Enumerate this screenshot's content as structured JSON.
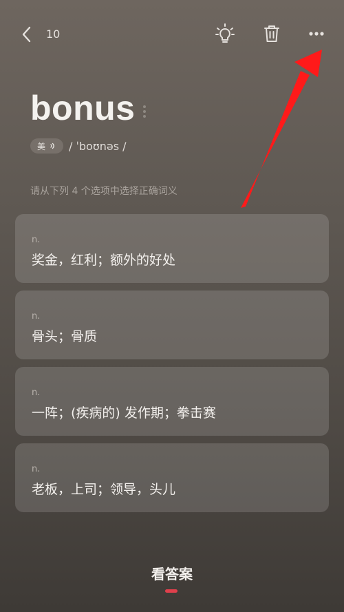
{
  "header": {
    "count": "10",
    "icons": [
      "back-chevron-icon",
      "lightbulb-icon",
      "trash-icon",
      "more-dots-icon"
    ]
  },
  "word": {
    "text": "bonus",
    "accent_label": "美",
    "phonetic": "/ ˈboʊnəs /"
  },
  "instruction": "请从下列 4 个选项中选择正确词义",
  "options": [
    {
      "pos": "n.",
      "meaning": "奖金，红利；额外的好处"
    },
    {
      "pos": "n.",
      "meaning": "骨头；骨质"
    },
    {
      "pos": "n.",
      "meaning": "一阵；(疾病的) 发作期；拳击赛"
    },
    {
      "pos": "n.",
      "meaning": "老板，上司；领导，头儿"
    }
  ],
  "footer": {
    "show_answer": "看答案"
  },
  "colors": {
    "accent": "#e0404c",
    "annotation_arrow": "#ff1a1a"
  }
}
